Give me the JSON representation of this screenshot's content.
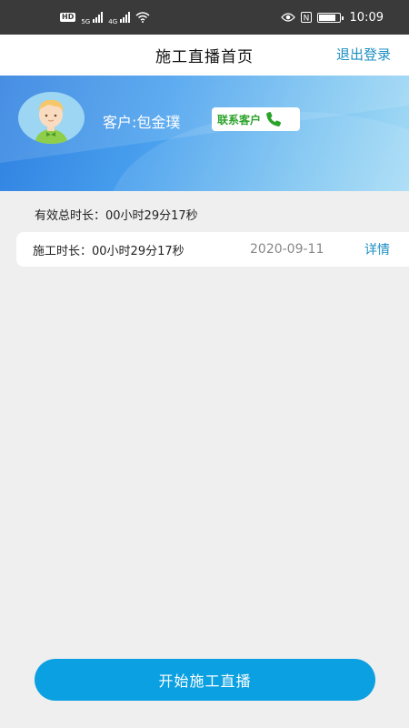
{
  "status_bar": {
    "hd_label": "HD",
    "network_1": "5G",
    "network_2": "4G",
    "nfc_label": "N",
    "time": "10:09"
  },
  "header": {
    "title": "施工直播首页",
    "logout_label": "退出登录"
  },
  "banner": {
    "customer_label": "客户:包金璞",
    "contact_label": "联系客户",
    "contact_icon": "phone-icon",
    "avatar_icon": "user-avatar-icon"
  },
  "summary": {
    "total_duration": "有效总时长：00小时29分17秒"
  },
  "records": [
    {
      "duration": "施工时长：00小时29分17秒",
      "date": "2020-09-11",
      "detail_label": "详情"
    }
  ],
  "footer": {
    "start_label": "开始施工直播"
  },
  "colors": {
    "accent": "#1c8fc3",
    "button": "#0ba0e2",
    "contact_green": "#2aa32a"
  }
}
